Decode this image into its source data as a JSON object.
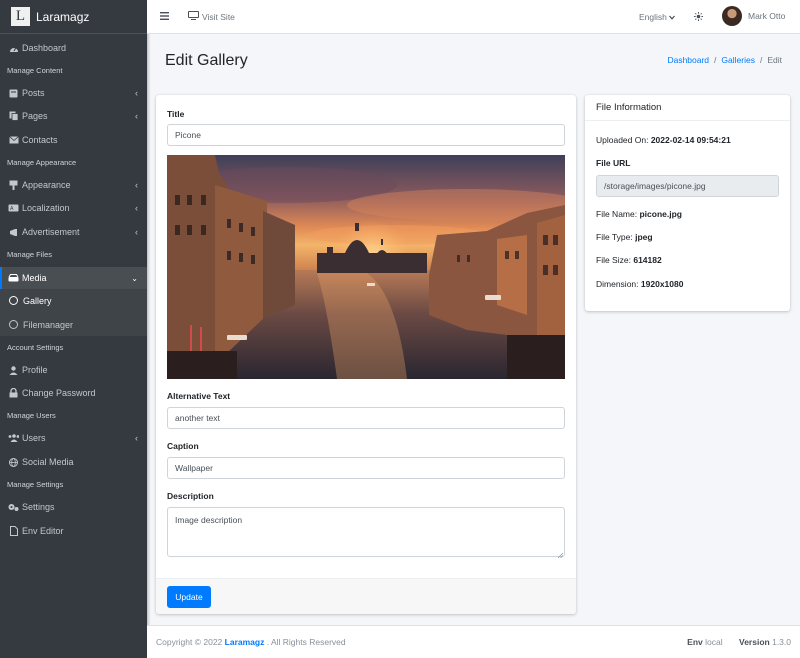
{
  "app": {
    "brand_letter": "L",
    "brand_name": "Laramagz"
  },
  "sidebar": {
    "dashboard": "Dashboard",
    "h_content": "Manage Content",
    "posts": "Posts",
    "pages": "Pages",
    "contacts": "Contacts",
    "h_appearance": "Manage Appearance",
    "appearance": "Appearance",
    "localization": "Localization",
    "advertisement": "Advertisement",
    "h_files": "Manage Files",
    "media": "Media",
    "gallery": "Gallery",
    "filemanager": "Filemanager",
    "h_account": "Account Settings",
    "profile": "Profile",
    "change_password": "Change Password",
    "h_users": "Manage Users",
    "users": "Users",
    "social_media": "Social Media",
    "h_settings": "Manage Settings",
    "settings": "Settings",
    "env_editor": "Env Editor"
  },
  "topbar": {
    "visit_site": "Visit Site",
    "language": "English",
    "user_name": "Mark Otto"
  },
  "header": {
    "title": "Edit Gallery",
    "breadcrumb": {
      "dashboard": "Dashboard",
      "galleries": "Galleries",
      "current": "Edit",
      "sep": "/"
    }
  },
  "form": {
    "title_label": "Title",
    "title_value": "Picone",
    "alt_label": "Alternative Text",
    "alt_value": "another text",
    "caption_label": "Caption",
    "caption_value": "Wallpaper",
    "description_label": "Description",
    "description_value": "Image description",
    "update_button": "Update"
  },
  "file_info": {
    "heading": "File Information",
    "uploaded_label": "Uploaded On:",
    "uploaded_value": "2022-02-14 09:54:21",
    "url_label": "File URL",
    "url_value": "/storage/images/picone.jpg",
    "name_label": "File Name:",
    "name_value": "picone.jpg",
    "type_label": "File Type:",
    "type_value": "jpeg",
    "size_label": "File Size:",
    "size_value": "614182",
    "dimension_label": "Dimension:",
    "dimension_value": "1920x1080"
  },
  "footer": {
    "copyright": "Copyright © 2022",
    "brand": "Laramagz",
    "rights": ". All Rights Reserved",
    "env_label": "Env",
    "env_value": "local",
    "version_label": "Version",
    "version_value": "1.3.0"
  },
  "colors": {
    "primary": "#007bff",
    "sidebar": "#343a40"
  }
}
